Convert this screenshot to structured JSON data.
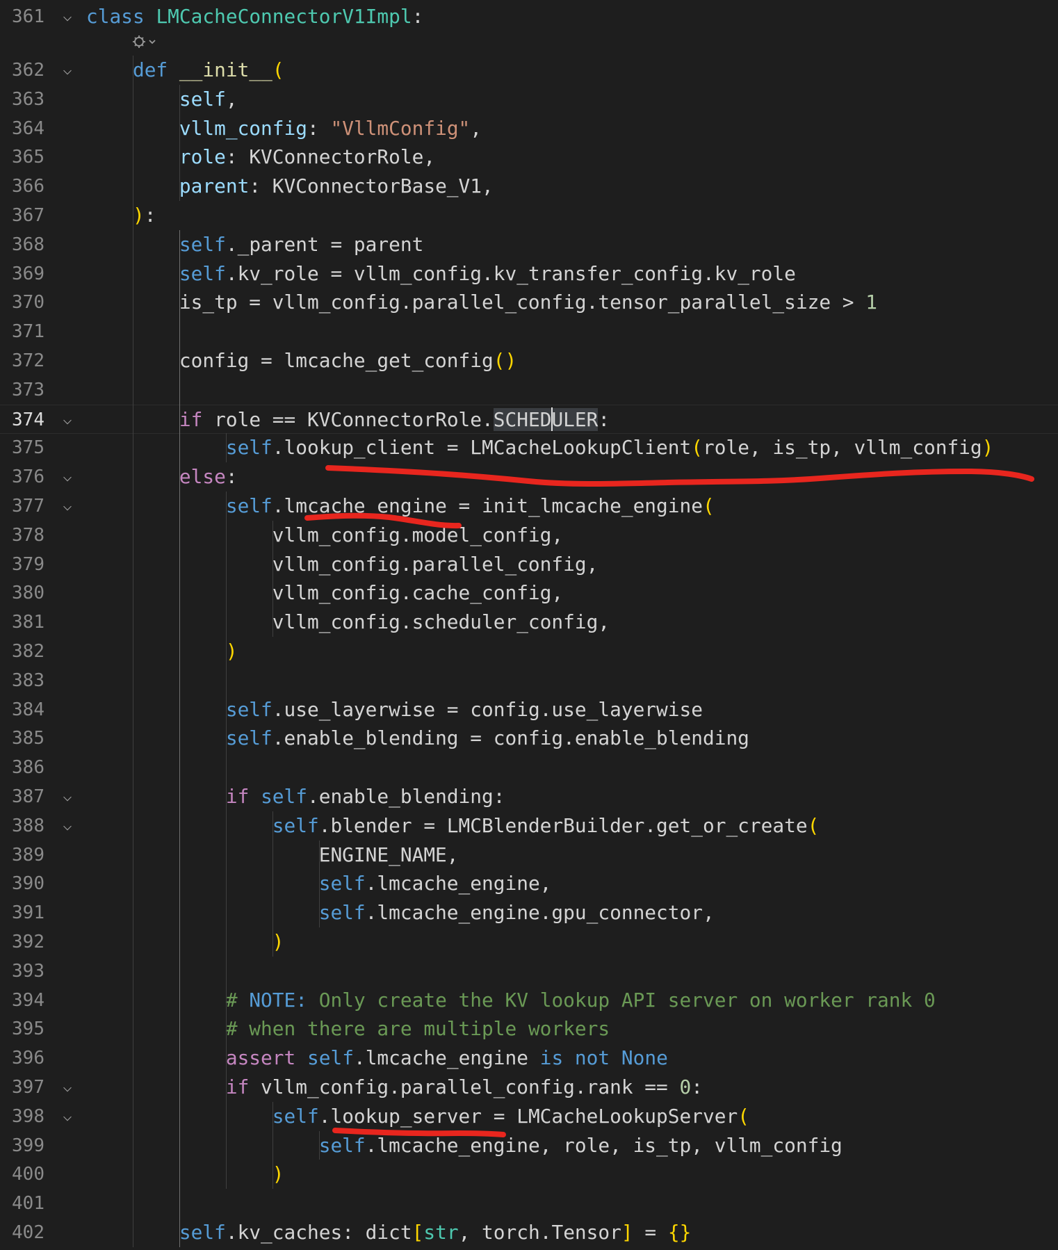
{
  "editor": {
    "lines": [
      {
        "number": "361",
        "fold": "⌵",
        "tokens": [
          [
            "class",
            "kw"
          ],
          [
            " ",
            ""
          ],
          [
            "LMCacheConnectorV1Impl",
            "cls"
          ],
          [
            ":",
            ""
          ]
        ]
      },
      {
        "number": "362",
        "fold": "⌵",
        "tokens": [
          [
            "    ",
            ""
          ],
          [
            "def",
            "kw"
          ],
          [
            " ",
            ""
          ],
          [
            "__init__",
            "fn"
          ],
          [
            "(",
            "br1"
          ]
        ]
      },
      {
        "number": "363",
        "fold": "",
        "tokens": [
          [
            "        ",
            ""
          ],
          [
            "self",
            "var"
          ],
          [
            ",",
            ""
          ]
        ]
      },
      {
        "number": "364",
        "fold": "",
        "tokens": [
          [
            "        ",
            ""
          ],
          [
            "vllm_config",
            "var"
          ],
          [
            ": ",
            ""
          ],
          [
            "\"VllmConfig\"",
            "str"
          ],
          [
            ",",
            ""
          ]
        ]
      },
      {
        "number": "365",
        "fold": "",
        "tokens": [
          [
            "        ",
            ""
          ],
          [
            "role",
            "var"
          ],
          [
            ": KVConnectorRole,",
            ""
          ]
        ]
      },
      {
        "number": "366",
        "fold": "",
        "tokens": [
          [
            "        ",
            ""
          ],
          [
            "parent",
            "var"
          ],
          [
            ": KVConnectorBase_V1,",
            ""
          ]
        ]
      },
      {
        "number": "367",
        "fold": "",
        "tokens": [
          [
            "    ",
            ""
          ],
          [
            ")",
            "br1"
          ],
          [
            ":",
            ""
          ]
        ]
      },
      {
        "number": "368",
        "fold": "",
        "tokens": [
          [
            "        ",
            ""
          ],
          [
            "self",
            "kw"
          ],
          [
            "._parent = parent",
            ""
          ]
        ]
      },
      {
        "number": "369",
        "fold": "",
        "tokens": [
          [
            "        ",
            ""
          ],
          [
            "self",
            "kw"
          ],
          [
            ".kv_role = vllm_config.kv_transfer_config.kv_role",
            ""
          ]
        ]
      },
      {
        "number": "370",
        "fold": "",
        "tokens": [
          [
            "        is_tp = vllm_config.parallel_config.tensor_parallel_size > ",
            ""
          ],
          [
            "1",
            "num"
          ]
        ]
      },
      {
        "number": "371",
        "fold": "",
        "tokens": []
      },
      {
        "number": "372",
        "fold": "",
        "tokens": [
          [
            "        config = lmcache_get_config",
            ""
          ],
          [
            "()",
            "br1"
          ]
        ]
      },
      {
        "number": "373",
        "fold": "",
        "tokens": []
      },
      {
        "number": "374",
        "fold": "⌵",
        "current": true,
        "tokens": [
          [
            "        ",
            ""
          ],
          [
            "if",
            "ctl"
          ],
          [
            " role == KVConnectorRole.",
            ""
          ],
          [
            "SCHEDULER",
            "sel"
          ],
          [
            ":",
            ""
          ]
        ]
      },
      {
        "number": "375",
        "fold": "",
        "tokens": [
          [
            "            ",
            ""
          ],
          [
            "self",
            "kw"
          ],
          [
            ".lookup_client = LMCacheLookupClient",
            ""
          ],
          [
            "(",
            "br1"
          ],
          [
            "role, is_tp, vllm_config",
            ""
          ],
          [
            ")",
            "br1"
          ]
        ]
      },
      {
        "number": "376",
        "fold": "⌵",
        "tokens": [
          [
            "        ",
            ""
          ],
          [
            "else",
            "ctl"
          ],
          [
            ":",
            ""
          ]
        ]
      },
      {
        "number": "377",
        "fold": "⌵",
        "tokens": [
          [
            "            ",
            ""
          ],
          [
            "self",
            "kw"
          ],
          [
            ".lmcache_engine = init_lmcache_engine",
            ""
          ],
          [
            "(",
            "br1"
          ]
        ]
      },
      {
        "number": "378",
        "fold": "",
        "tokens": [
          [
            "                vllm_config.model_config,",
            ""
          ]
        ]
      },
      {
        "number": "379",
        "fold": "",
        "tokens": [
          [
            "                vllm_config.parallel_config,",
            ""
          ]
        ]
      },
      {
        "number": "380",
        "fold": "",
        "tokens": [
          [
            "                vllm_config.cache_config,",
            ""
          ]
        ]
      },
      {
        "number": "381",
        "fold": "",
        "tokens": [
          [
            "                vllm_config.scheduler_config,",
            ""
          ]
        ]
      },
      {
        "number": "382",
        "fold": "",
        "tokens": [
          [
            "            ",
            ""
          ],
          [
            ")",
            "br1"
          ]
        ]
      },
      {
        "number": "383",
        "fold": "",
        "tokens": []
      },
      {
        "number": "384",
        "fold": "",
        "tokens": [
          [
            "            ",
            ""
          ],
          [
            "self",
            "kw"
          ],
          [
            ".use_layerwise = config.use_layerwise",
            ""
          ]
        ]
      },
      {
        "number": "385",
        "fold": "",
        "tokens": [
          [
            "            ",
            ""
          ],
          [
            "self",
            "kw"
          ],
          [
            ".enable_blending = config.enable_blending",
            ""
          ]
        ]
      },
      {
        "number": "386",
        "fold": "",
        "tokens": []
      },
      {
        "number": "387",
        "fold": "⌵",
        "tokens": [
          [
            "            ",
            ""
          ],
          [
            "if",
            "ctl"
          ],
          [
            " ",
            ""
          ],
          [
            "self",
            "kw"
          ],
          [
            ".enable_blending:",
            ""
          ]
        ]
      },
      {
        "number": "388",
        "fold": "⌵",
        "tokens": [
          [
            "                ",
            ""
          ],
          [
            "self",
            "kw"
          ],
          [
            ".blender = LMCBlenderBuilder.get_or_create",
            ""
          ],
          [
            "(",
            "br1"
          ]
        ]
      },
      {
        "number": "389",
        "fold": "",
        "tokens": [
          [
            "                    ENGINE_NAME,",
            ""
          ]
        ]
      },
      {
        "number": "390",
        "fold": "",
        "tokens": [
          [
            "                    ",
            ""
          ],
          [
            "self",
            "kw"
          ],
          [
            ".lmcache_engine,",
            ""
          ]
        ]
      },
      {
        "number": "391",
        "fold": "",
        "tokens": [
          [
            "                    ",
            ""
          ],
          [
            "self",
            "kw"
          ],
          [
            ".lmcache_engine.gpu_connector,",
            ""
          ]
        ]
      },
      {
        "number": "392",
        "fold": "",
        "tokens": [
          [
            "                ",
            ""
          ],
          [
            ")",
            "br1"
          ]
        ]
      },
      {
        "number": "393",
        "fold": "",
        "tokens": []
      },
      {
        "number": "394",
        "fold": "",
        "tokens": [
          [
            "            ",
            ""
          ],
          [
            "# ",
            "cm"
          ],
          [
            "NOTE:",
            "cmb"
          ],
          [
            " Only create the KV lookup API server on worker rank 0",
            "cm"
          ]
        ]
      },
      {
        "number": "395",
        "fold": "",
        "tokens": [
          [
            "            ",
            ""
          ],
          [
            "# when there are multiple workers",
            "cm"
          ]
        ]
      },
      {
        "number": "396",
        "fold": "",
        "tokens": [
          [
            "            ",
            ""
          ],
          [
            "assert",
            "ctl"
          ],
          [
            " ",
            ""
          ],
          [
            "self",
            "kw"
          ],
          [
            ".lmcache_engine ",
            ""
          ],
          [
            "is not",
            "kw"
          ],
          [
            " ",
            ""
          ],
          [
            "None",
            "kw"
          ]
        ]
      },
      {
        "number": "397",
        "fold": "⌵",
        "tokens": [
          [
            "            ",
            ""
          ],
          [
            "if",
            "ctl"
          ],
          [
            " vllm_config.parallel_config.rank == ",
            ""
          ],
          [
            "0",
            "num"
          ],
          [
            ":",
            ""
          ]
        ]
      },
      {
        "number": "398",
        "fold": "⌵",
        "tokens": [
          [
            "                ",
            ""
          ],
          [
            "self",
            "kw"
          ],
          [
            ".lookup_server = LMCacheLookupServer",
            ""
          ],
          [
            "(",
            "br1"
          ]
        ]
      },
      {
        "number": "399",
        "fold": "",
        "tokens": [
          [
            "                    ",
            ""
          ],
          [
            "self",
            "kw"
          ],
          [
            ".lmcache_engine, role, is_tp, vllm_config",
            ""
          ]
        ]
      },
      {
        "number": "400",
        "fold": "",
        "tokens": [
          [
            "                ",
            ""
          ],
          [
            ")",
            "br1"
          ]
        ]
      },
      {
        "number": "401",
        "fold": "",
        "tokens": []
      },
      {
        "number": "402",
        "fold": "",
        "tokens": [
          [
            "        ",
            ""
          ],
          [
            "self",
            "kw"
          ],
          [
            ".kv_caches: dict",
            ""
          ],
          [
            "[",
            "br1"
          ],
          [
            "str",
            "cls"
          ],
          [
            ", torch.Tensor",
            ""
          ],
          [
            "]",
            "br1"
          ],
          [
            " = ",
            ""
          ],
          [
            "{}",
            "br1"
          ]
        ]
      }
    ],
    "codelens_icon": "copilot-sparkle-icon",
    "annotation_color": "#e8261e"
  }
}
